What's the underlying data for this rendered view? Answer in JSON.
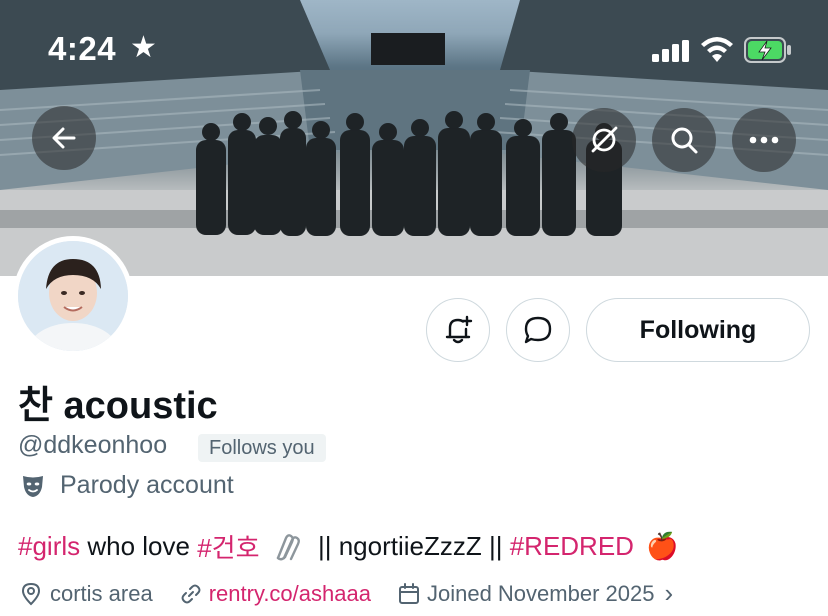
{
  "status_bar": {
    "time": "4:24",
    "star_glyph": "★"
  },
  "banner": {
    "description_icon": "stadium-photo"
  },
  "nav": {
    "back_icon": "arrow-left-icon",
    "grok_icon": "slash-circle-icon",
    "search_icon": "search-icon",
    "more_icon": "more-icon"
  },
  "profile": {
    "display_name": "찬 acoustic",
    "handle": "@ddkeonhoo",
    "follows_you": "Follows you",
    "parody_label": "Parody account",
    "follow_button": "Following"
  },
  "bio": {
    "tag1": "#girls",
    "text1": " who love ",
    "tag2": "#건호",
    "text2": "  || ngortiieZzzZ || ",
    "tag3": "#REDRED",
    "emoji_apple": "🍎"
  },
  "meta": {
    "location": "cortis area",
    "link": "rentry.co/ashaaa",
    "joined": "Joined November 2025",
    "chevron": "›"
  },
  "colors": {
    "accent": "#d4256e",
    "secondary_text": "#536471",
    "border": "#cfd9de"
  }
}
